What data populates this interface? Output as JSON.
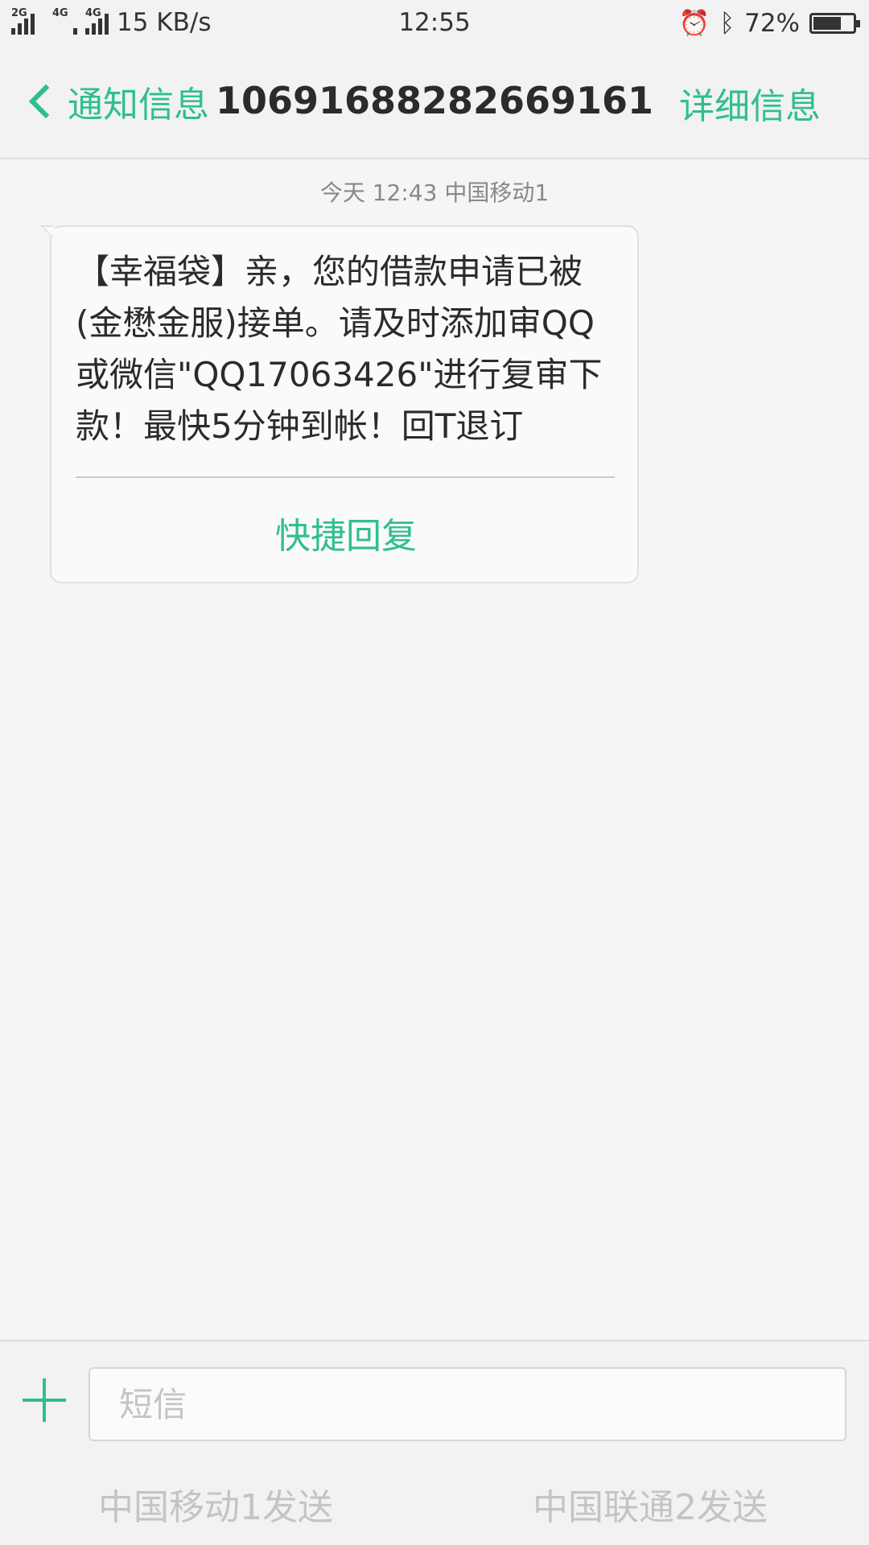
{
  "status_bar": {
    "network_1": "2G",
    "network_2": "4G",
    "network_3": "4G",
    "speed": "15 KB/s",
    "time": "12:55",
    "battery": "72%",
    "battery_level": 0.72,
    "icons": [
      "alarm-icon",
      "bluetooth-icon",
      "battery-icon"
    ]
  },
  "header": {
    "back_label": "通知信息",
    "title": "10691688282669161",
    "detail_label": "详细信息"
  },
  "message": {
    "meta": "今天 12:43  中国移动1",
    "text": "【幸福袋】亲，您的借款申请已被(金懋金服)接单。请及时添加审QQ或微信\"QQ17063426\"进行复审下款！最快5分钟到帐！回T退订",
    "quick_reply": "快捷回复"
  },
  "composer": {
    "placeholder": "短信",
    "send_sim1": "中国移动1发送",
    "send_sim2": "中国联通2发送"
  },
  "colors": {
    "accent": "#2fbf8d",
    "background": "#f5f5f5"
  }
}
